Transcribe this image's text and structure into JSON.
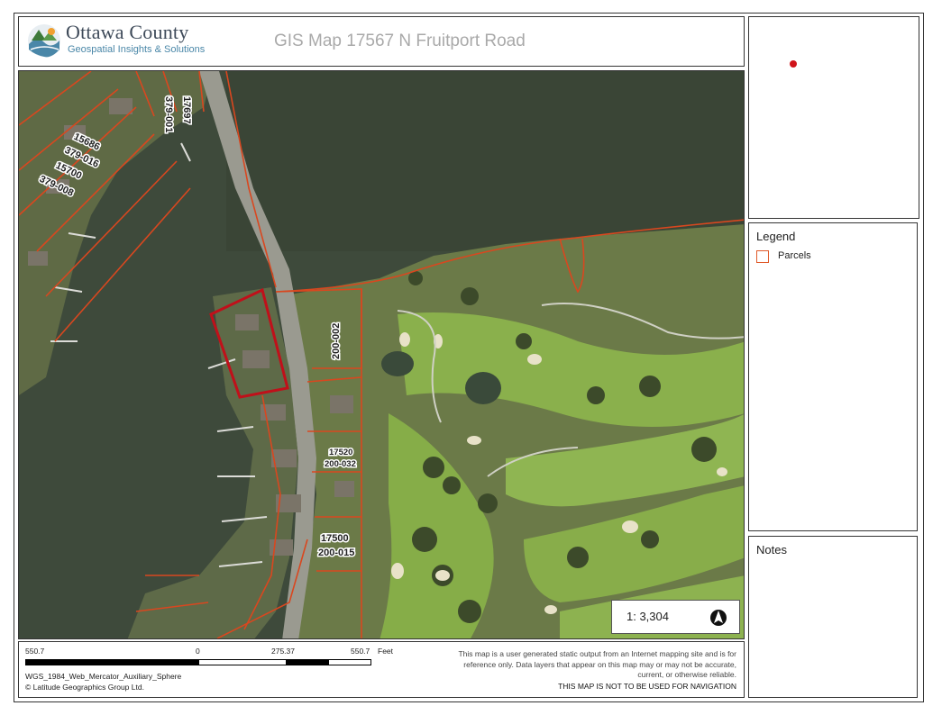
{
  "header": {
    "org_name": "Ottawa County",
    "org_tagline": "Geospatial Insights & Solutions",
    "map_title": "GIS Map 17567 N Fruitport Road"
  },
  "map": {
    "parcel_labels": [
      {
        "text": "17697",
        "rotate": 90
      },
      {
        "text": "379-001",
        "rotate": 90
      },
      {
        "text": "15686",
        "rotate": 25
      },
      {
        "text": "379-016",
        "rotate": 25
      },
      {
        "text": "15700",
        "rotate": 25
      },
      {
        "text": "379-008",
        "rotate": 25
      },
      {
        "text": "200-002",
        "rotate": -90
      },
      {
        "text": "17520",
        "rotate": 0
      },
      {
        "text": "200-032",
        "rotate": 0
      },
      {
        "text": "17500",
        "rotate": 0
      },
      {
        "text": "200-015",
        "rotate": 0
      }
    ],
    "scale_text": "1: 3,304",
    "north_arrow": "north-arrow-icon",
    "colors": {
      "water": "#3f4a3a",
      "land": "#6a7a4a",
      "fairway": "#8bb04a",
      "parcel_outline": "#d9471f",
      "selected_parcel": "#c0101a"
    }
  },
  "overview": {
    "marker_color": "#d0141a"
  },
  "legend": {
    "title": "Legend",
    "items": [
      {
        "label": "Parcels",
        "swatch": "#e05a2a"
      }
    ]
  },
  "notes": {
    "title": "Notes"
  },
  "footer": {
    "scale_labels": {
      "left": "550.7",
      "zero": "0",
      "mid": "275.37",
      "right": "550.7",
      "unit": "Feet"
    },
    "projection": "WGS_1984_Web_Mercator_Auxiliary_Sphere",
    "copyright": "© Latitude Geographics Group Ltd.",
    "disclaimer": "This map is a user generated static output from an Internet mapping site and is for reference only. Data layers that appear on this map may or may not be accurate, current, or otherwise reliable.",
    "nav_warning": "THIS MAP IS NOT TO BE USED FOR NAVIGATION"
  }
}
